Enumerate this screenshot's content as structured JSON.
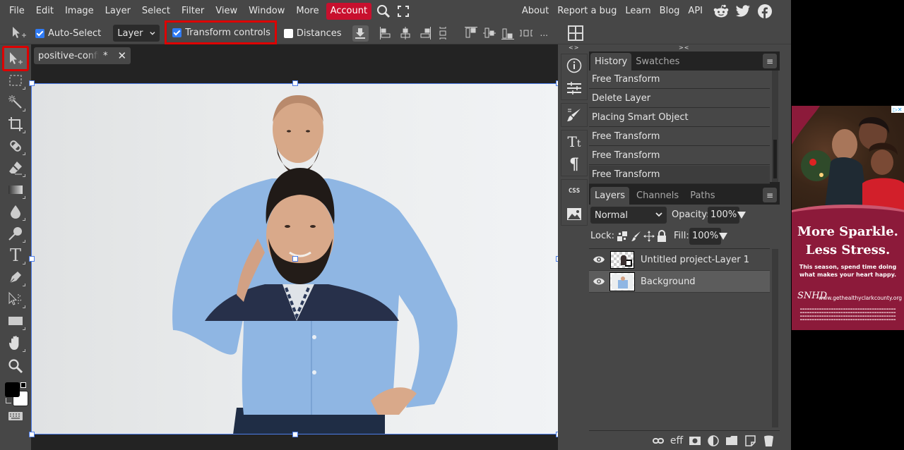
{
  "menu": {
    "items": [
      "File",
      "Edit",
      "Image",
      "Layer",
      "Select",
      "Filter",
      "View",
      "Window",
      "More"
    ],
    "account": "Account",
    "right_links": [
      "About",
      "Report a bug",
      "Learn",
      "Blog",
      "API"
    ],
    "social_icons": [
      "reddit-icon",
      "twitter-icon",
      "facebook-icon"
    ]
  },
  "options": {
    "auto_select_label": "Auto-Select",
    "auto_select_checked": true,
    "select_target": "Layer",
    "transform_controls_label": "Transform controls",
    "transform_controls_checked": true,
    "distances_label": "Distances",
    "distances_checked": false,
    "more_label": "..."
  },
  "document": {
    "tab_name": "positive-confident",
    "modified_marker": "*",
    "close_label": "✕"
  },
  "tools": [
    "move-tool",
    "marquee-tool",
    "magic-wand-tool",
    "crop-tool",
    "healing-tool",
    "eraser-tool",
    "gradient-tool",
    "blur-tool",
    "dodge-tool",
    "type-tool",
    "pen-tool",
    "path-select-tool",
    "shape-tool",
    "hand-tool",
    "zoom-tool"
  ],
  "colors": {
    "foreground": "#000000",
    "background": "#ffffff",
    "accent": "#2f7bf5",
    "highlight_red": "#dd0000",
    "account_red": "#c8102e"
  },
  "side_icons": {
    "collapse_left": "<>",
    "collapse_right": "><",
    "css_label": "CSS"
  },
  "history": {
    "tabs": [
      "History",
      "Swatches"
    ],
    "items": [
      "Free Transform",
      "Delete Layer",
      "Placing Smart Object",
      "Free Transform",
      "Free Transform",
      "Free Transform"
    ]
  },
  "layers": {
    "tabs": [
      "Layers",
      "Channels",
      "Paths"
    ],
    "blend_mode": "Normal",
    "opacity_label": "Opacity:",
    "opacity_value": "100%",
    "lock_label": "Lock:",
    "fill_label": "Fill:",
    "fill_value": "100%",
    "items": [
      {
        "name": "Untitled project-Layer 1",
        "visible": true,
        "selected": false
      },
      {
        "name": "Background",
        "visible": true,
        "selected": true
      }
    ],
    "bottom_icons": [
      "link-icon",
      "effects-icon",
      "mask-icon",
      "adjustment-icon",
      "folder-icon",
      "new-layer-icon",
      "trash-icon"
    ],
    "effects_label": "eff"
  },
  "ad": {
    "headline_1": "More Sparkle.",
    "headline_2": "Less Stress.",
    "subtext": "This season, spend time doing what makes your heart happy.",
    "site": "www.gethealthyclarkcounty.org",
    "logo": "SNHD",
    "adchoices": "▷✕"
  }
}
